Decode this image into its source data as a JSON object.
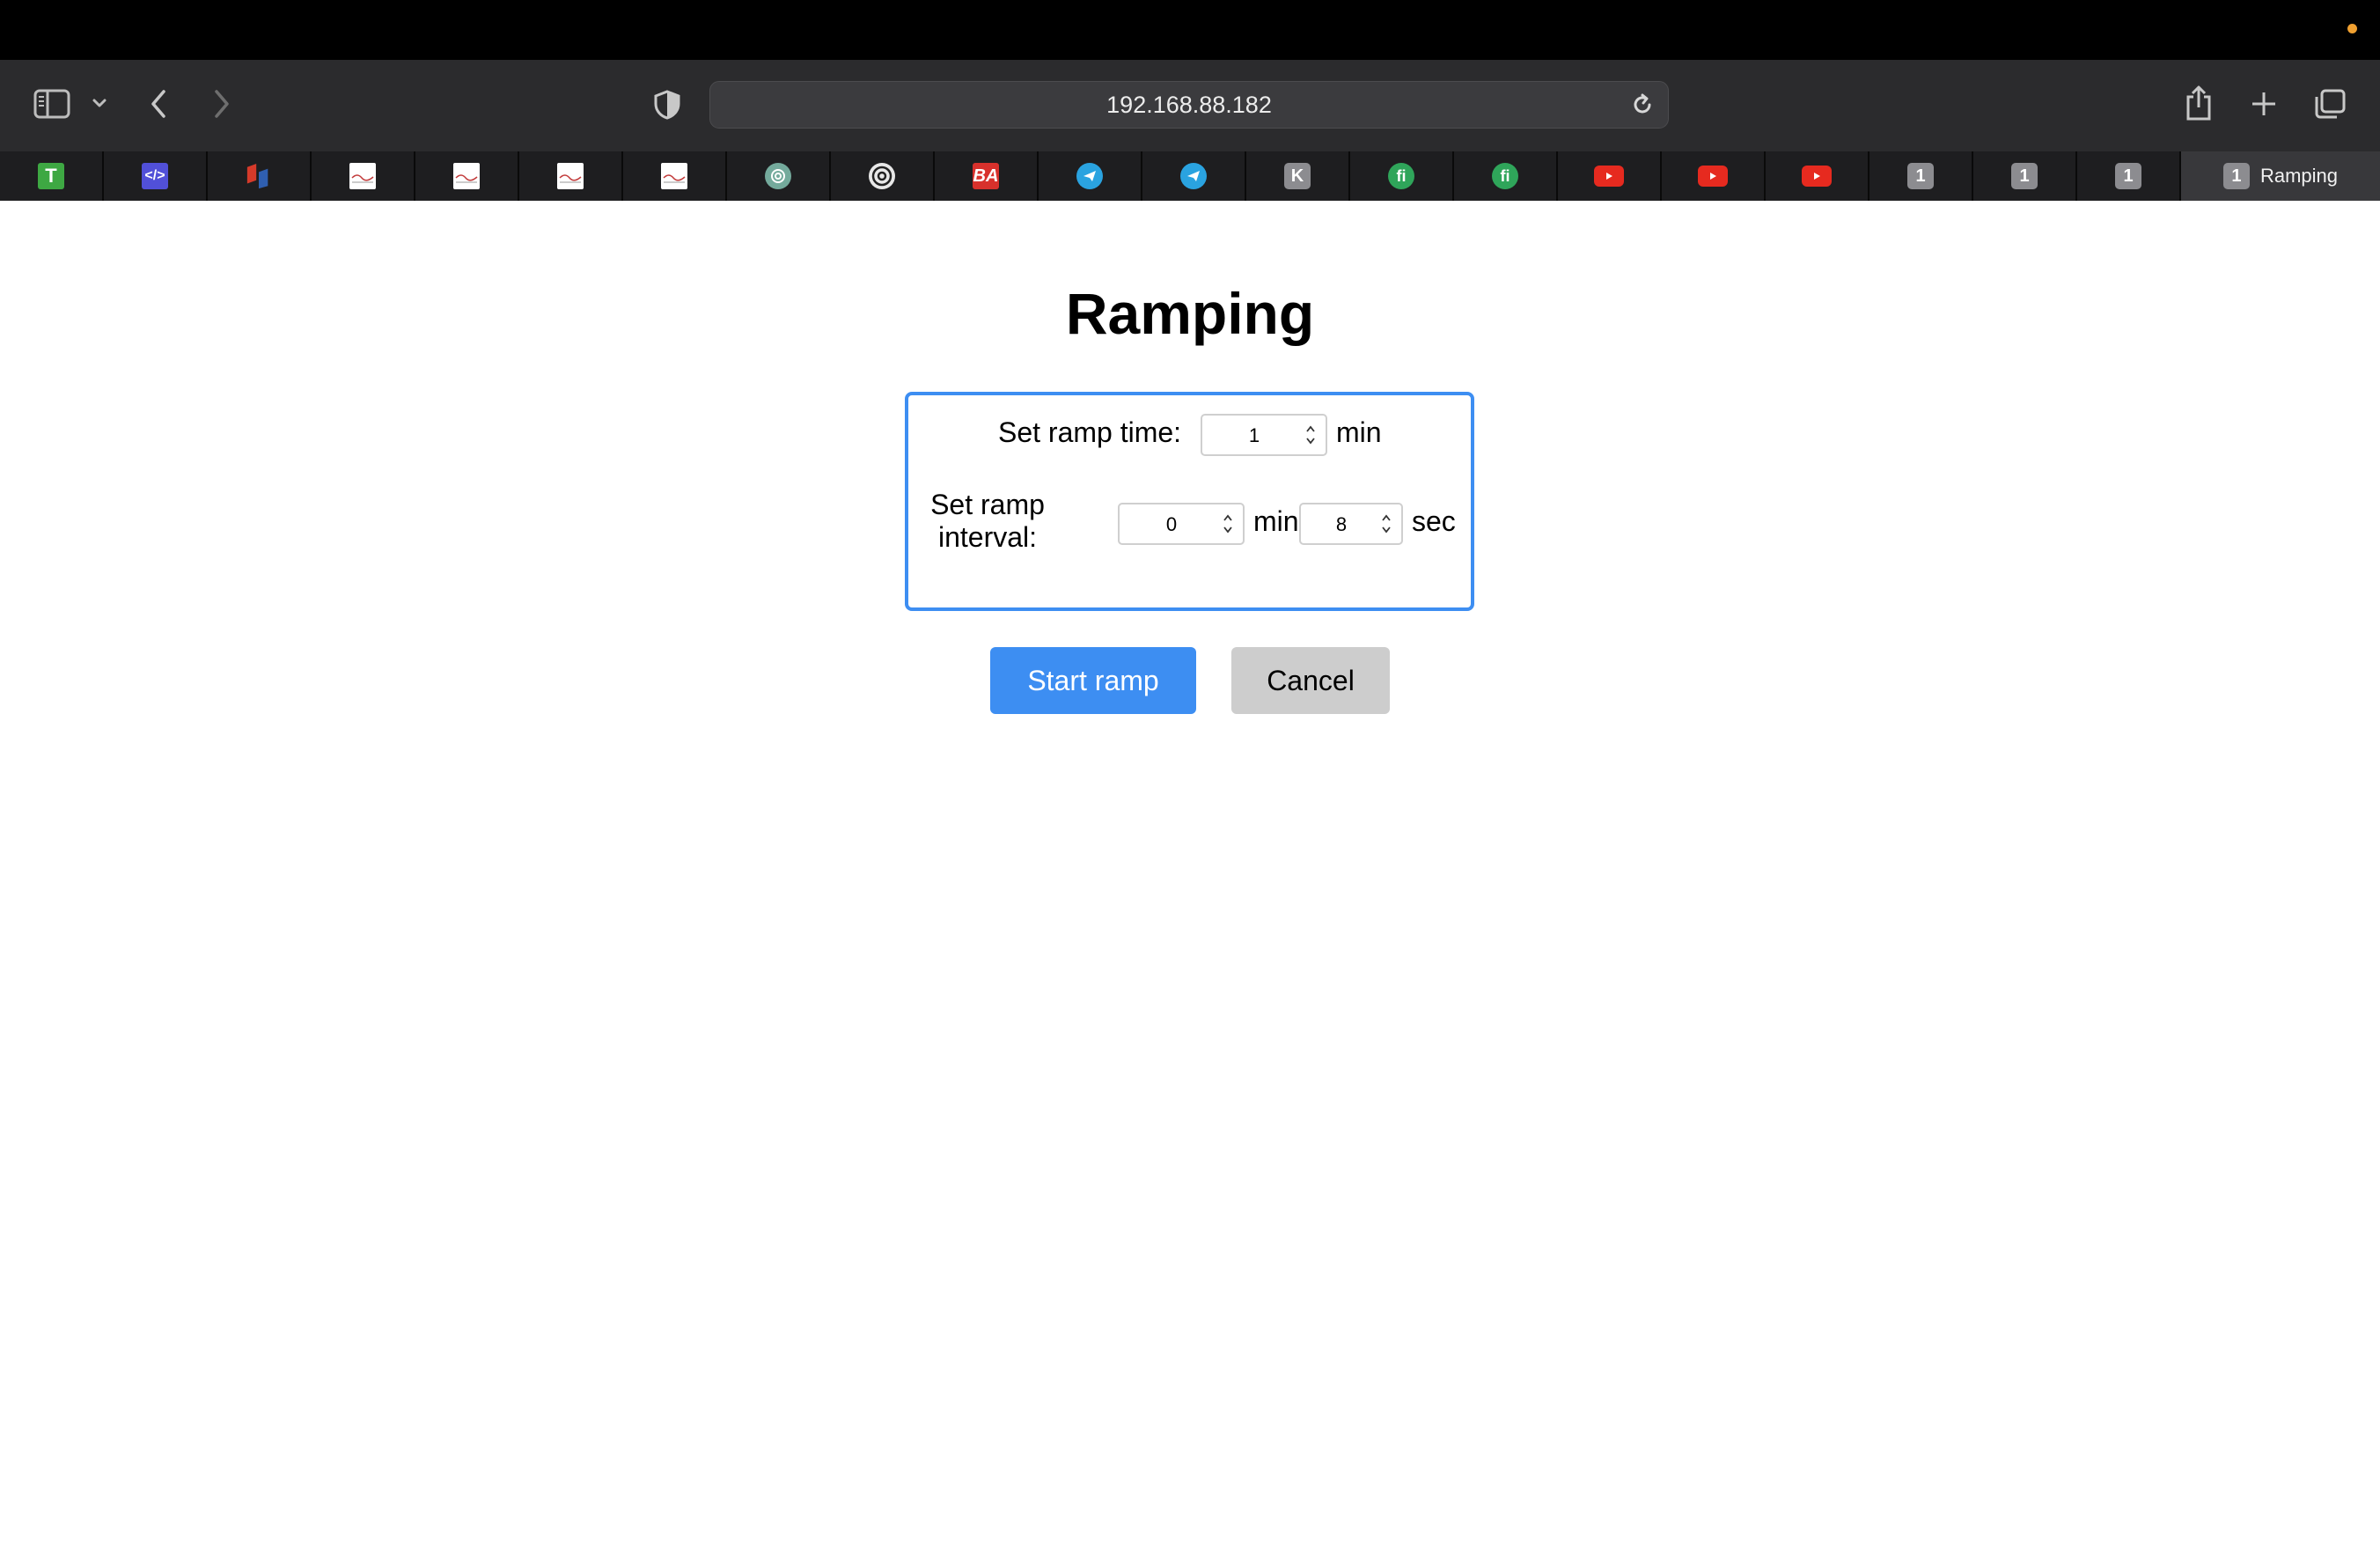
{
  "browser": {
    "url": "192.168.88.182",
    "tabs": [
      {
        "favicon": "t-icon",
        "label": "T"
      },
      {
        "favicon": "code-icon",
        "label": "</>"
      },
      {
        "favicon": "red-blue-logo-icon"
      },
      {
        "favicon": "chart-thumbnail-icon"
      },
      {
        "favicon": "chart-thumbnail-icon"
      },
      {
        "favicon": "chart-thumbnail-icon"
      },
      {
        "favicon": "chart-thumbnail-icon"
      },
      {
        "favicon": "chatgpt-icon"
      },
      {
        "favicon": "at-sign-icon"
      },
      {
        "favicon": "ba-icon",
        "label": "BA"
      },
      {
        "favicon": "telegram-icon"
      },
      {
        "favicon": "telegram-icon"
      },
      {
        "favicon": "k-icon",
        "label": "K"
      },
      {
        "favicon": "fi-icon",
        "label": "fi"
      },
      {
        "favicon": "fi-icon",
        "label": "fi"
      },
      {
        "favicon": "youtube-icon"
      },
      {
        "favicon": "youtube-icon"
      },
      {
        "favicon": "youtube-icon"
      },
      {
        "favicon": "number-icon",
        "label": "1"
      },
      {
        "favicon": "number-icon",
        "label": "1"
      },
      {
        "favicon": "number-icon",
        "label": "1"
      },
      {
        "favicon": "number-icon",
        "label": "1",
        "title": "Ramping",
        "active": true
      }
    ]
  },
  "page": {
    "title": "Ramping",
    "ramp_time": {
      "label": "Set ramp time:",
      "value": "1",
      "unit": "min"
    },
    "ramp_interval": {
      "label_line1": "Set ramp",
      "label_line2": "interval:",
      "min_value": "0",
      "min_unit": "min",
      "sec_value": "8",
      "sec_unit": "sec"
    },
    "buttons": {
      "start": "Start ramp",
      "cancel": "Cancel"
    }
  },
  "colors": {
    "accent": "#3d8ef2",
    "cancel_bg": "#cdcdcd",
    "youtube": "#e62a1f",
    "recording_dot": "#f0a030"
  }
}
